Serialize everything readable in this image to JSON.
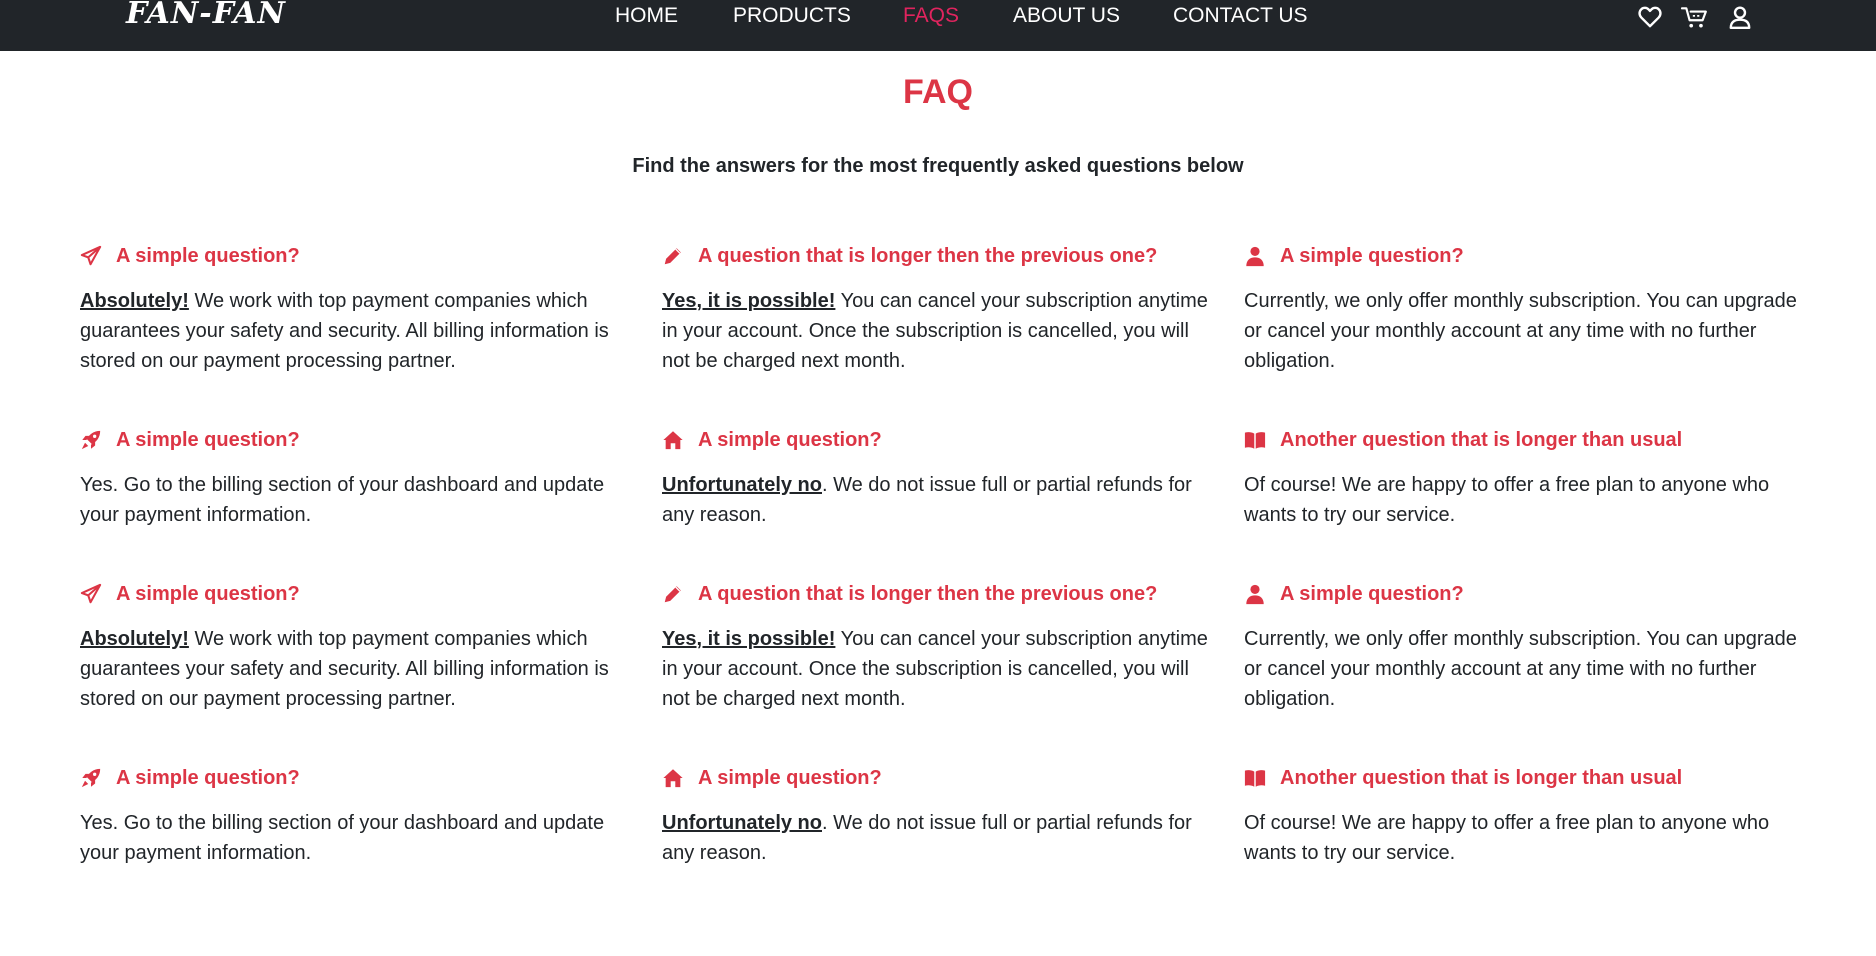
{
  "nav": {
    "logo": "FAN-FAN",
    "links": [
      {
        "label": "HOME",
        "active": false
      },
      {
        "label": "PRODUCTS",
        "active": false
      },
      {
        "label": "FAQS",
        "active": true
      },
      {
        "label": "ABOUT US",
        "active": false
      },
      {
        "label": "CONTACT US",
        "active": false
      }
    ],
    "icons": [
      "heart-icon",
      "cart-icon",
      "user-icon"
    ]
  },
  "page": {
    "title": "FAQ",
    "subtitle": "Find the answers for the most frequently asked questions below"
  },
  "colors": {
    "navbar": "#212529",
    "accent": "#dc3545",
    "active_link": "#e0245e",
    "text": "#212529"
  },
  "faqs": [
    {
      "icon": "paper-plane-icon",
      "question": "A simple question?",
      "lead": "Absolutely!",
      "answer": " We work with top payment companies which guarantees your safety and security. All billing information is stored on our payment processing partner."
    },
    {
      "icon": "pencil-icon",
      "question": "A question that is longer then the previous one?",
      "lead": "Yes, it is possible!",
      "answer": " You can cancel your subscription anytime in your account. Once the subscription is cancelled, you will not be charged next month."
    },
    {
      "icon": "user-icon",
      "question": "A simple question?",
      "lead": "",
      "answer": "Currently, we only offer monthly subscription. You can upgrade or cancel your monthly account at any time with no further obligation."
    },
    {
      "icon": "rocket-icon",
      "question": "A simple question?",
      "lead": "",
      "answer": "Yes. Go to the billing section of your dashboard and update your payment information."
    },
    {
      "icon": "home-icon",
      "question": "A simple question?",
      "lead": "Unfortunately no",
      "answer": ". We do not issue full or partial refunds for any reason."
    },
    {
      "icon": "book-icon",
      "question": "Another question that is longer than usual",
      "lead": "",
      "answer": "Of course! We are happy to offer a free plan to anyone who wants to try our service."
    },
    {
      "icon": "paper-plane-icon",
      "question": "A simple question?",
      "lead": "Absolutely!",
      "answer": " We work with top payment companies which guarantees your safety and security. All billing information is stored on our payment processing partner."
    },
    {
      "icon": "pencil-icon",
      "question": "A question that is longer then the previous one?",
      "lead": "Yes, it is possible!",
      "answer": " You can cancel your subscription anytime in your account. Once the subscription is cancelled, you will not be charged next month."
    },
    {
      "icon": "user-icon",
      "question": "A simple question?",
      "lead": "",
      "answer": "Currently, we only offer monthly subscription. You can upgrade or cancel your monthly account at any time with no further obligation."
    },
    {
      "icon": "rocket-icon",
      "question": "A simple question?",
      "lead": "",
      "answer": "Yes. Go to the billing section of your dashboard and update your payment information."
    },
    {
      "icon": "home-icon",
      "question": "A simple question?",
      "lead": "Unfortunately no",
      "answer": ". We do not issue full or partial refunds for any reason."
    },
    {
      "icon": "book-icon",
      "question": "Another question that is longer than usual",
      "lead": "",
      "answer": "Of course! We are happy to offer a free plan to anyone who wants to try our service."
    }
  ]
}
